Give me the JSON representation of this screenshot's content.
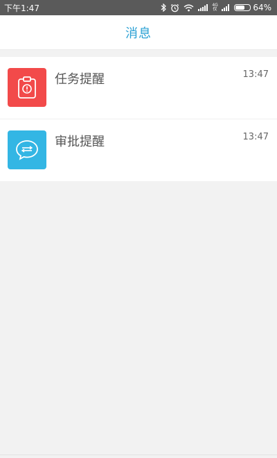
{
  "status_bar": {
    "time": "下午1:47",
    "network_badge_top": "4G",
    "network_badge_bottom": "仅",
    "battery_percent": 64,
    "battery_label": "64%",
    "icons": [
      "bluetooth-icon",
      "alarm-icon",
      "wifi-icon",
      "signal-icon",
      "signal-icon",
      "battery-icon"
    ]
  },
  "header": {
    "title": "消息"
  },
  "messages": [
    {
      "title": "任务提醒",
      "time": "13:47",
      "icon": "task-clipboard-icon",
      "color": "#f24a4a"
    },
    {
      "title": "审批提醒",
      "time": "13:47",
      "icon": "approval-chat-icon",
      "color": "#33b6e4"
    }
  ],
  "colors": {
    "accent": "#2aa0d4",
    "status_bar": "#5a5a5a",
    "background": "#f2f2f2"
  }
}
